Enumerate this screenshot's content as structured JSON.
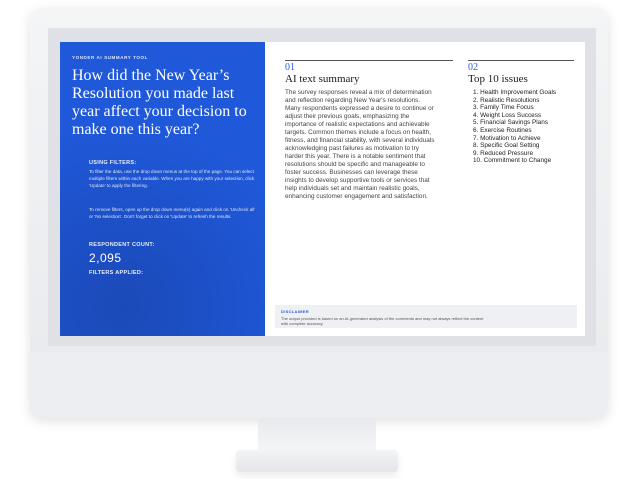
{
  "left": {
    "tool_name": "YONDER AI SUMMARY TOOL",
    "question": "How did the New Year’s Resolution you made last year affect your decision to make one this year?",
    "using_filters_label": "USING FILTERS:",
    "using_filters_text": "To filter the data, use the drop down menus at the top of the page. You can select multiple filters within each variable. When you are happy with your selection, click 'Update' to apply the filtering.",
    "remove_filters_text": "To remove filters, open up the drop down menu(s) again and click on 'Uncheck all' or 'No selection'. Don't forget to click on 'Update' to refresh the results.",
    "respondent_count_label": "RESPONDENT COUNT:",
    "respondent_count": "2,095",
    "filters_applied_label": "FILTERS APPLIED:"
  },
  "summary": {
    "number": "01",
    "title": "AI text summary",
    "text": "The survey responses reveal a mix of determination and reflection regarding New Year's resolutions. Many respondents expressed a desire to continue or adjust their previous goals, emphasizing the importance of realistic expectations and achievable targets. Common themes include a focus on health, fitness, and financial stability, with several individuals acknowledging past failures as motivation to try harder this year. There is a notable sentiment that resolutions should be specific and manageable to foster success. Businesses can leverage these insights to develop supportive tools or services that help individuals set and maintain realistic goals, enhancing customer engagement and satisfaction."
  },
  "issues": {
    "number": "02",
    "title": "Top 10 issues",
    "items": [
      "1. Health Improvement Goals",
      "2. Realistic Resolutions",
      "3. Family Time Focus",
      "4. Weight Loss Success",
      "5. Financial Savings Plans",
      "6. Exercise Routines",
      "7. Motivation to Achieve",
      "8. Specific Goal Setting",
      "9. Reduced Pressure",
      "10. Commitment to Change"
    ]
  },
  "disclaimer": {
    "title": "DISCLAIMER",
    "text": "The output provided is based on an AI-generated analysis of the comments and may not always reflect the content with complete accuracy."
  }
}
